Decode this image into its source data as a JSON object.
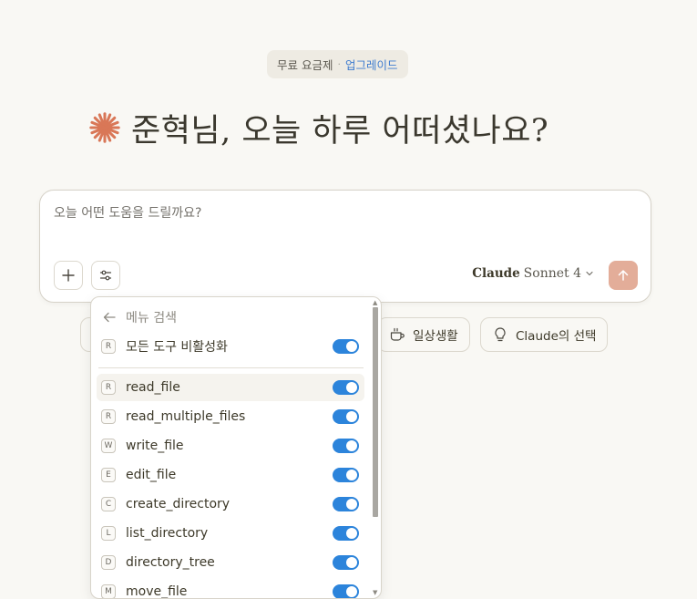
{
  "plan_badge": {
    "plan": "무료 요금제",
    "separator": "·",
    "upgrade": "업그레이드"
  },
  "greeting": "준혁님, 오늘 하루 어떠셨나요?",
  "prompt": {
    "placeholder": "오늘 어떤 도움을 드릴까요?",
    "model_brand": "Claude",
    "model_version": "Sonnet 4"
  },
  "chips": [
    {
      "label": "일상생활",
      "icon": "coffee-cup-icon"
    },
    {
      "label": "Claude의 선택",
      "icon": "lightbulb-icon"
    }
  ],
  "tools_menu": {
    "back_label": "메뉴 검색",
    "disable_all": {
      "key": "R",
      "label": "모든 도구 비활성화",
      "enabled": true
    },
    "items": [
      {
        "key": "R",
        "label": "read_file",
        "enabled": true
      },
      {
        "key": "R",
        "label": "read_multiple_files",
        "enabled": true
      },
      {
        "key": "W",
        "label": "write_file",
        "enabled": true
      },
      {
        "key": "E",
        "label": "edit_file",
        "enabled": true
      },
      {
        "key": "C",
        "label": "create_directory",
        "enabled": true
      },
      {
        "key": "L",
        "label": "list_directory",
        "enabled": true
      },
      {
        "key": "D",
        "label": "directory_tree",
        "enabled": true
      },
      {
        "key": "M",
        "label": "move_file",
        "enabled": true
      }
    ]
  },
  "colors": {
    "accent_star": "#d97757",
    "toggle_on": "#2c84db",
    "send_button": "#e3ad99",
    "upgrade_link": "#3f7ccf"
  }
}
